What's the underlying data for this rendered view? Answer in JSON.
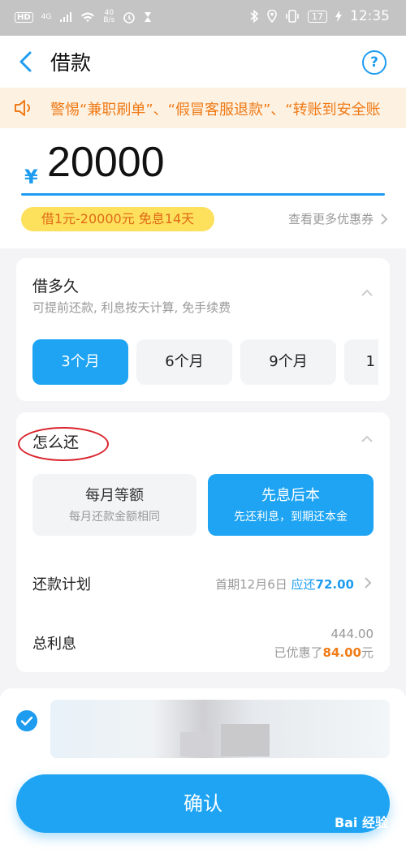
{
  "status_bar": {
    "network_badge": "HD",
    "signal_label": "4G",
    "speed_value": "40",
    "speed_unit": "B/s",
    "battery": "17",
    "time": "12:35"
  },
  "nav": {
    "title": "借款"
  },
  "notice": {
    "text": "警惕“兼职刷单”、“假冒客服退款”、“转账到安全账"
  },
  "amount": {
    "currency": "¥",
    "value": "20000",
    "promo": "借1元-20000元 免息14天",
    "coupon_link": "查看更多优惠券"
  },
  "term": {
    "title": "借多久",
    "subtitle": "可提前还款, 利息按天计算, 免手续费",
    "options": [
      "3个月",
      "6个月",
      "9个月",
      "1"
    ],
    "selected_index": 0
  },
  "repay": {
    "title": "怎么还",
    "methods": [
      {
        "title": "每月等额",
        "subtitle": "每月还款金额相同"
      },
      {
        "title": "先息后本",
        "subtitle": "先还利息，到期还本金"
      }
    ],
    "selected_index": 1,
    "plan_label": "还款计划",
    "plan_first": "首期12月6日",
    "plan_due_label": "应还",
    "plan_due_amount": "72.00",
    "interest_label": "总利息",
    "interest_value": "444.00",
    "discount_prefix": "已优惠了",
    "discount_amount": "84.00",
    "discount_suffix": "元"
  },
  "confirm": {
    "label": "确认"
  },
  "watermark": "Bai 经验",
  "colors": {
    "accent": "#1ea4f3",
    "warning": "#ef7a17",
    "promo_bg": "#fde05b",
    "annotation": "#d9232b"
  }
}
